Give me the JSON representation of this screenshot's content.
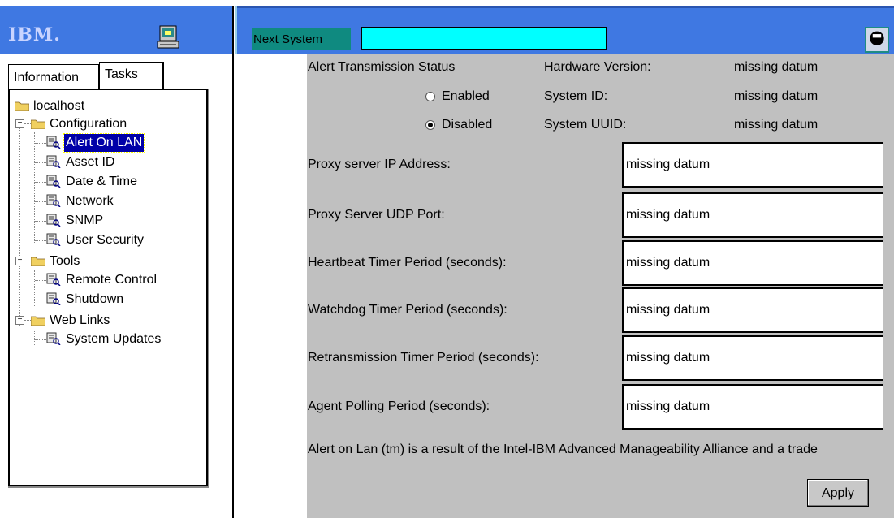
{
  "brand": {
    "logo": "IBM."
  },
  "topbar": {
    "next_system_label": "Next System",
    "next_system_value": ""
  },
  "left": {
    "tabs": [
      "Information",
      "Tasks"
    ],
    "tree": {
      "root": "localhost",
      "configuration": "Configuration",
      "config_items": [
        "Alert On LAN",
        "Asset ID",
        "Date & Time",
        "Network",
        "SNMP",
        "User Security"
      ],
      "tools": "Tools",
      "tools_items": [
        "Remote Control",
        "Shutdown"
      ],
      "weblinks": "Web Links",
      "weblinks_items": [
        "System Updates"
      ],
      "selected": "Alert On LAN"
    }
  },
  "form": {
    "alert_status_label": "Alert Transmission Status",
    "radio_enabled": "Enabled",
    "radio_disabled": "Disabled",
    "radio_selected": "Disabled",
    "info": [
      {
        "label": "Hardware Version:",
        "value": "missing datum"
      },
      {
        "label": "System ID:",
        "value": "missing datum"
      },
      {
        "label": "System UUID:",
        "value": "missing datum"
      }
    ],
    "fields": [
      {
        "label": "Proxy server IP Address:",
        "value": "missing datum"
      },
      {
        "label": "Proxy Server UDP Port:",
        "value": "missing datum"
      },
      {
        "label": "Heartbeat Timer Period (seconds):",
        "value": "missing datum"
      },
      {
        "label": "Watchdog Timer Period (seconds):",
        "value": "missing datum"
      },
      {
        "label": "Retransmission Timer Period (seconds):",
        "value": "missing datum"
      },
      {
        "label": "Agent Polling Period (seconds):",
        "value": "missing datum"
      }
    ],
    "footnote": "Alert on Lan (tm) is a result of the Intel-IBM Advanced Manageability Alliance and a trade",
    "apply": "Apply"
  }
}
